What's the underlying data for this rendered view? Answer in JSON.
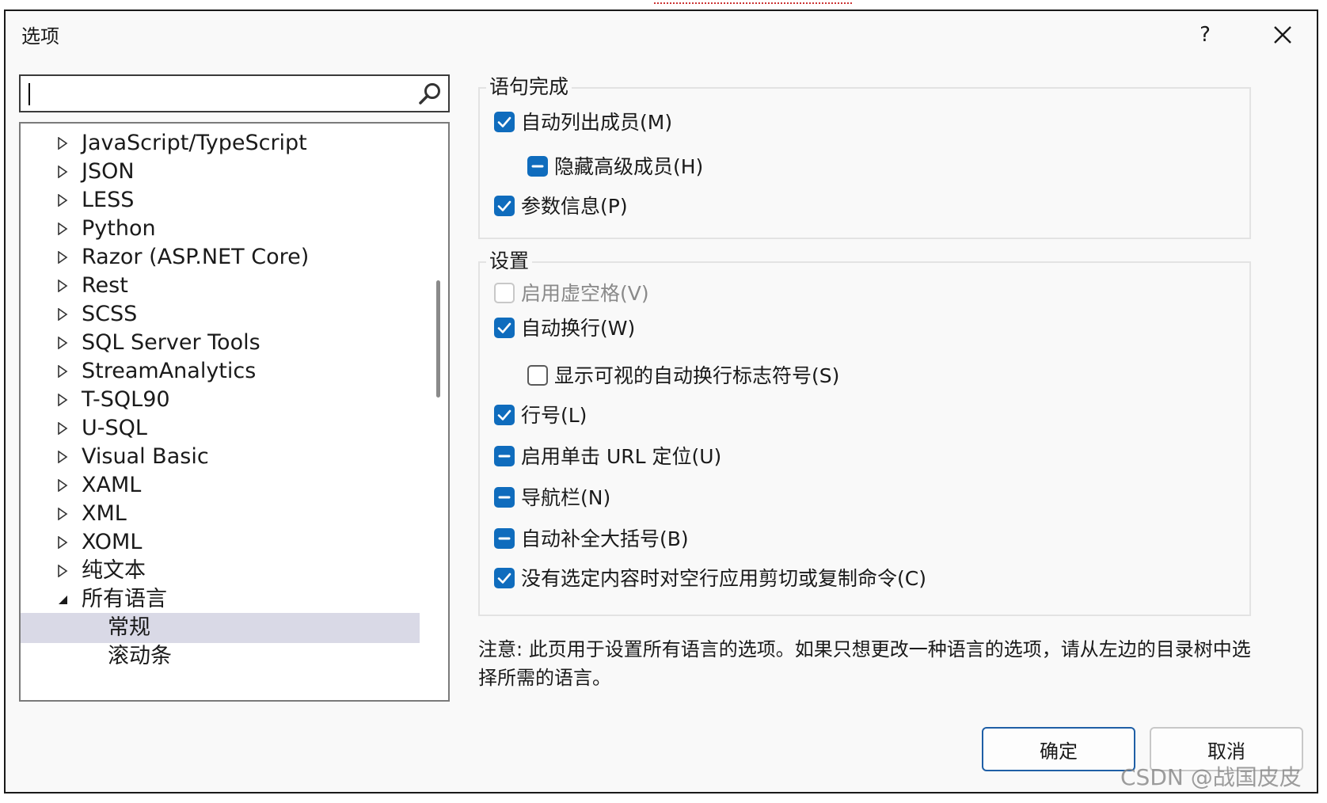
{
  "window": {
    "title": "选项",
    "help_label": "?"
  },
  "search": {
    "value": "",
    "placeholder": ""
  },
  "tree": {
    "items": [
      {
        "label": "JavaScript/TypeScript",
        "expanded": false
      },
      {
        "label": "JSON",
        "expanded": false
      },
      {
        "label": "LESS",
        "expanded": false
      },
      {
        "label": "Python",
        "expanded": false
      },
      {
        "label": "Razor (ASP.NET Core)",
        "expanded": false
      },
      {
        "label": "Rest",
        "expanded": false
      },
      {
        "label": "SCSS",
        "expanded": false
      },
      {
        "label": "SQL Server Tools",
        "expanded": false
      },
      {
        "label": "StreamAnalytics",
        "expanded": false
      },
      {
        "label": "T-SQL90",
        "expanded": false
      },
      {
        "label": "U-SQL",
        "expanded": false
      },
      {
        "label": "Visual Basic",
        "expanded": false
      },
      {
        "label": "XAML",
        "expanded": false
      },
      {
        "label": "XML",
        "expanded": false
      },
      {
        "label": "XOML",
        "expanded": false
      },
      {
        "label": "纯文本",
        "expanded": false
      },
      {
        "label": "所有语言",
        "expanded": true
      },
      {
        "label": "常规",
        "selected": true
      },
      {
        "label": "滚动条"
      }
    ]
  },
  "statement_completion": {
    "title": "语句完成",
    "options": [
      {
        "label": "自动列出成员(M)",
        "state": "checked"
      },
      {
        "label": "隐藏高级成员(H)",
        "state": "mixed"
      },
      {
        "label": "参数信息(P)",
        "state": "checked"
      }
    ]
  },
  "settings": {
    "title": "设置",
    "options": [
      {
        "label": "启用虚空格(V)",
        "state": "disabled"
      },
      {
        "label": "自动换行(W)",
        "state": "checked"
      },
      {
        "label": "显示可视的自动换行标志符号(S)",
        "state": "unchecked"
      },
      {
        "label": "行号(L)",
        "state": "checked"
      },
      {
        "label": "启用单击 URL 定位(U)",
        "state": "mixed"
      },
      {
        "label": "导航栏(N)",
        "state": "mixed"
      },
      {
        "label": "自动补全大括号(B)",
        "state": "mixed"
      },
      {
        "label": "没有选定内容时对空行应用剪切或复制命令(C)",
        "state": "checked"
      }
    ]
  },
  "note": "注意: 此页用于设置所有语言的选项。如果只想更改一种语言的选项，请从左边的目录树中选择所需的语言。",
  "buttons": {
    "ok": "确定",
    "cancel": "取消"
  },
  "watermark": "CSDN @战国皮皮",
  "colors": {
    "accent": "#0f6cbd",
    "selection": "#d9d9e6",
    "dialog_bg": "#f9f9f9"
  }
}
